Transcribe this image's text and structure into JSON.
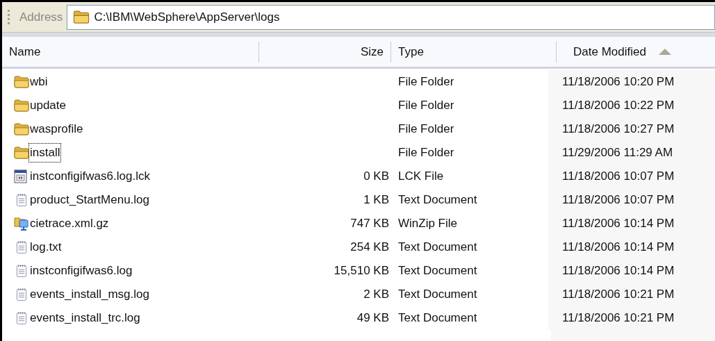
{
  "address_bar": {
    "label": "Address",
    "path": "C:\\IBM\\WebSphere\\AppServer\\logs"
  },
  "columns": [
    {
      "label": "Name",
      "sorted": false
    },
    {
      "label": "Size",
      "sorted": false
    },
    {
      "label": "Type",
      "sorted": false
    },
    {
      "label": "Date Modified",
      "sorted": true
    }
  ],
  "files": [
    {
      "name": "wbi",
      "kind": "folder",
      "type": "File Folder",
      "date": "11/18/2006 10:20 PM",
      "focused": false
    },
    {
      "name": "update",
      "kind": "folder",
      "type": "File Folder",
      "date": "11/18/2006 10:22 PM",
      "focused": false
    },
    {
      "name": "wasprofile",
      "kind": "folder",
      "type": "File Folder",
      "date": "11/18/2006 10:27 PM",
      "focused": false
    },
    {
      "name": "install",
      "kind": "folder",
      "type": "File Folder",
      "date": "11/29/2006 11:29 AM",
      "focused": true
    },
    {
      "name": "instconfigifwas6.log.lck",
      "kind": "app",
      "size": "0 KB",
      "type": "LCK File",
      "date": "11/18/2006 10:07 PM",
      "focused": false
    },
    {
      "name": "product_StartMenu.log",
      "kind": "text",
      "size": "1 KB",
      "type": "Text Document",
      "date": "11/18/2006 10:07 PM",
      "focused": false
    },
    {
      "name": "cietrace.xml.gz",
      "kind": "zip",
      "size": "747 KB",
      "type": "WinZip File",
      "date": "11/18/2006 10:14 PM",
      "focused": false
    },
    {
      "name": "log.txt",
      "kind": "text",
      "size": "254 KB",
      "type": "Text Document",
      "date": "11/18/2006 10:14 PM",
      "focused": false
    },
    {
      "name": "instconfigifwas6.log",
      "kind": "text",
      "size": "15,510 KB",
      "type": "Text Document",
      "date": "11/18/2006 10:14 PM",
      "focused": false
    },
    {
      "name": "events_install_msg.log",
      "kind": "text",
      "size": "2 KB",
      "type": "Text Document",
      "date": "11/18/2006 10:21 PM",
      "focused": false
    },
    {
      "name": "events_install_trc.log",
      "kind": "text",
      "size": "49 KB",
      "type": "Text Document",
      "date": "11/18/2006 10:21 PM",
      "focused": false
    }
  ]
}
